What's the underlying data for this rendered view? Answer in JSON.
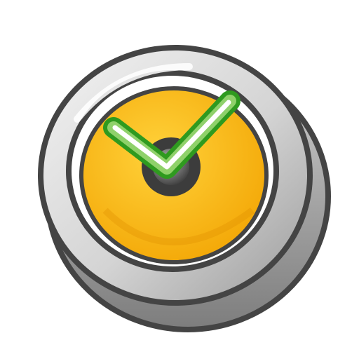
{
  "icon": {
    "name": "timer-check-icon",
    "colors": {
      "outline": "#444444",
      "bezel_light": "#f3f3f3",
      "bezel_mid": "#d4d4d4",
      "bezel_dark": "#9a9a9a",
      "face_light": "#ffd23a",
      "face_dark": "#f2a200",
      "check_green": "#2f9a1f",
      "check_light_green": "#8fd16a",
      "check_highlight": "#ffffff",
      "hub_dark": "#3c3c3c",
      "hub_light": "#b8b8b8"
    }
  }
}
